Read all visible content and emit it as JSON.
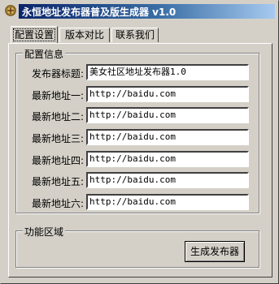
{
  "window": {
    "title": "永恒地址发布器普及版生成器 v1.0",
    "icon": "app-icon"
  },
  "tabs": [
    {
      "label": "配置设置",
      "active": true
    },
    {
      "label": "版本对比",
      "active": false
    },
    {
      "label": "联系我们",
      "active": false
    }
  ],
  "config_group": {
    "legend": "配置信息",
    "rows": [
      {
        "label": "发布器标题:",
        "value": "美女社区地址发布器1.0"
      },
      {
        "label": "最新地址一:",
        "value": "http://baidu.com"
      },
      {
        "label": "最新地址二:",
        "value": "http://baidu.com"
      },
      {
        "label": "最新地址三:",
        "value": "http://baidu.com"
      },
      {
        "label": "最新地址四:",
        "value": "http://baidu.com"
      },
      {
        "label": "最新地址五:",
        "value": "http://baidu.com"
      },
      {
        "label": "最新地址六:",
        "value": "http://baidu.com"
      }
    ]
  },
  "function_group": {
    "legend": "功能区域",
    "generate_button": "生成发布器"
  }
}
